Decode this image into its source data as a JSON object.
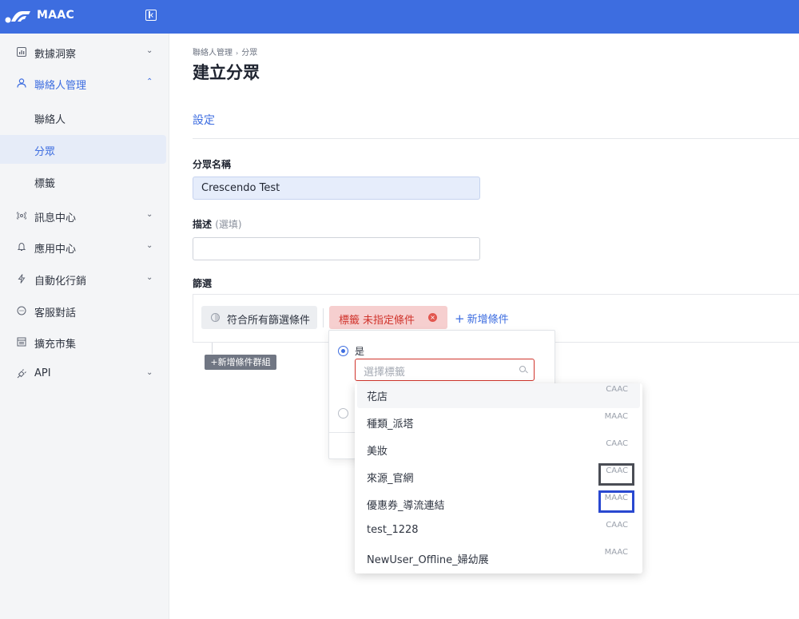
{
  "brand": {
    "name": "MAAC"
  },
  "sidebar": {
    "items": [
      {
        "label": "數據洞察",
        "icon": "chart-icon",
        "chevron": "⌄"
      },
      {
        "label": "聯絡人管理",
        "icon": "user-icon",
        "chevron": "⌃"
      },
      {
        "label": "聯絡人"
      },
      {
        "label": "分眾"
      },
      {
        "label": "標籤"
      },
      {
        "label": "訊息中心",
        "icon": "broadcast-icon",
        "chevron": "⌄"
      },
      {
        "label": "應用中心",
        "icon": "bell-icon",
        "chevron": "⌄"
      },
      {
        "label": "自動化行銷",
        "icon": "bolt-icon",
        "chevron": "⌄"
      },
      {
        "label": "客服對話",
        "icon": "chat-icon"
      },
      {
        "label": "擴充市集",
        "icon": "store-icon"
      },
      {
        "label": "API",
        "icon": "plug-icon",
        "chevron": "⌄"
      }
    ]
  },
  "breadcrumb": {
    "parent": "聯絡人管理",
    "sep": "›",
    "current": "分眾"
  },
  "page": {
    "title": "建立分眾",
    "section": "設定"
  },
  "form": {
    "name_label": "分眾名稱",
    "name_value": "Crescendo Test",
    "desc_label": "描述",
    "desc_optional": "(選填)",
    "desc_value": "",
    "filter_label": "篩選"
  },
  "filter": {
    "match_all": "符合所有篩選條件",
    "chip_key": "標籤",
    "chip_value": "未指定條件",
    "chip_remove": "×",
    "add_condition": "新增條件",
    "add_condition_plus": "+",
    "add_group": "+新增條件群組"
  },
  "popover": {
    "radio_yes": "是",
    "search_placeholder": "選擇標籤"
  },
  "tag_options": [
    {
      "name": "花店",
      "source": "CAAC"
    },
    {
      "name": "種類_派塔",
      "source": "MAAC"
    },
    {
      "name": "美妝",
      "source": "CAAC"
    },
    {
      "name": "來源_官網",
      "source": "CAAC"
    },
    {
      "name": "優惠券_導流連結",
      "source": "MAAC"
    },
    {
      "name": "test_1228",
      "source": "CAAC"
    },
    {
      "name": "NewUser_Offline_婦幼展",
      "source": "MAAC"
    }
  ],
  "colors": {
    "accent": "#3d6de0",
    "danger": "#d0342c",
    "highlight_gray": "#4a4d55",
    "highlight_blue": "#2948d0"
  }
}
